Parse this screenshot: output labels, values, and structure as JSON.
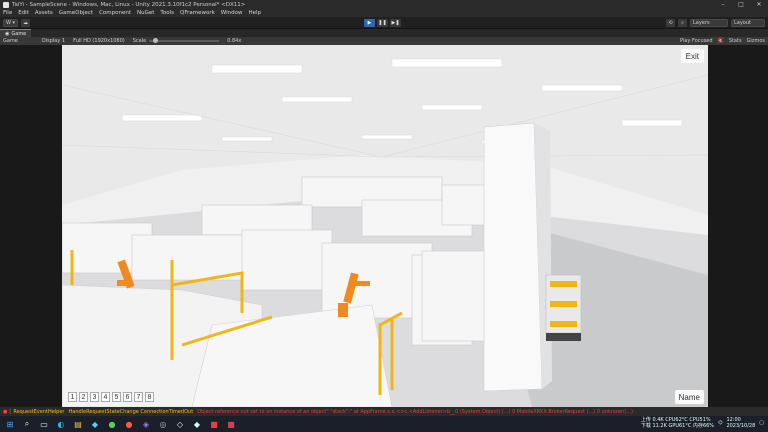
{
  "window": {
    "title": "TaiYi - SampleScene - Windows, Mac, Linux - Unity 2021.3.10f1c2 Personal* <DX11>",
    "min_icon": "–",
    "max_icon": "□",
    "close_icon": "✕"
  },
  "menu": [
    "File",
    "Edit",
    "Assets",
    "GameObject",
    "Component",
    "NuGet",
    "Tools",
    "QFramework",
    "Window",
    "Help"
  ],
  "toolbar": {
    "account": "W ▾",
    "cloud": "☁",
    "play": "▶",
    "pause": "❚❚",
    "step": "▶❚",
    "layers": "Layers",
    "layout": "Layout"
  },
  "tab": {
    "label": "Game"
  },
  "gamebar": {
    "view": "Game",
    "display": "Display 1",
    "resolution": "Full HD (1920x1080)",
    "scale_label": "Scale",
    "scale_value": "0.84x",
    "play_focused": "Play Focused",
    "stats": "Stats",
    "gizmos": "Gizmos"
  },
  "viewport": {
    "exit_label": "Exit",
    "name_label": "Name",
    "camera_buttons": [
      "1",
      "2",
      "3",
      "4",
      "5",
      "6",
      "7",
      "8"
    ]
  },
  "console": {
    "error_tag": "[",
    "t1": "RequestEventHelper",
    "t2": "HandleRequestStateChange ConnectionTimedOut",
    "t3": "Object reference not set to an instance of an object\" \"stack\":\" at AppFrame.s.x.<>c.<AddListener>b__0 (System.Object) (...) 0 MobileXRKit.BrokerRequest (...) 0 unknown(...)"
  },
  "tray": {
    "line1a": "上传 0.4K  CPU62°C  CPU51%",
    "line1b": "下载 11.2K  GPU61°C  内存66%",
    "time": "12:00",
    "date": "2023/10/28"
  },
  "colors": {
    "robot": "#f08a1f",
    "rail": "#f2b516",
    "play_active": "#2e67b1"
  }
}
